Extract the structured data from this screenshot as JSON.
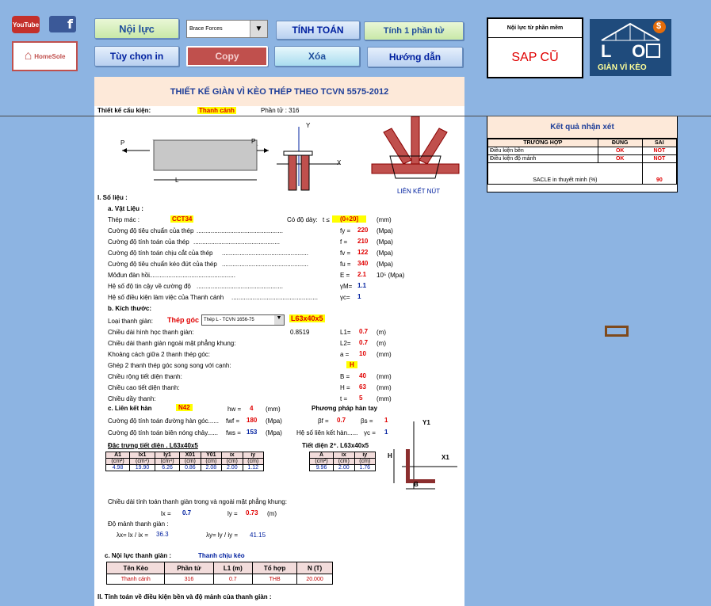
{
  "toolbar": {
    "noi_luc": "Nội lực",
    "brace_select": "Brace Forces",
    "tinh_toan": "TÍNH TOÁN",
    "tinh_1": "Tính 1 phần tử",
    "tuy_chon": "Tùy chọn in",
    "copy": "Copy",
    "xoa": "Xóa",
    "huong_dan": "Hướng dẫn",
    "youtube": "YouTube",
    "facebook": "f",
    "homesole": "HomeSole"
  },
  "software": {
    "title": "Nội lực từ phần mềm",
    "value": "SAP CŨ"
  },
  "logo": {
    "text": "GIÀN VÌ KÈO",
    "letters": "L O",
    "dollar": "$"
  },
  "sheet": {
    "title": "THIẾT KẾ GIÀN VÌ KÈO THÉP THEO TCVN 5575-2012",
    "component_label": "Thiết kế cấu kiện:",
    "component_value": "Thanh cánh",
    "element_label": "Phần tử : 316",
    "diagram": {
      "p_left": "P",
      "p_right": "P",
      "l": "L",
      "y": "Y",
      "x": "X",
      "joint": "LIÊN KẾT NÚT"
    },
    "sec1": "I. Số liệu :",
    "a": "a. Vật Liệu :",
    "thep_mac": "Thép mác :",
    "thep_mac_val": "CCT34",
    "thickness_label": "Có độ dày:",
    "t_label": "t ≤",
    "t_val": "(0÷20]",
    "mm": "(mm)",
    "props": [
      {
        "label": "Cường độ tiêu chuẩn của thép",
        "sym": "fy =",
        "val": "220",
        "unit": "(Mpa)"
      },
      {
        "label": "Cường độ tính toán của thép",
        "sym": "f =",
        "val": "210",
        "unit": "(Mpa)"
      },
      {
        "label": "Cường độ tính toán chịu cắt của thép",
        "sym": "fv =",
        "val": "122",
        "unit": "(Mpa)"
      },
      {
        "label": "Cường độ tiêu chuẩn kéo đứt của thép",
        "sym": "fu =",
        "val": "340",
        "unit": "(Mpa)"
      },
      {
        "label": "Môđun đàn hồi",
        "sym": "E =",
        "val": "2.1",
        "unit": "10⁵ (Mpa)"
      },
      {
        "label": "Hệ số độ tin cậy về cường độ",
        "sym": "γM=",
        "val": "1.1",
        "unit": ""
      },
      {
        "label": "Hệ số điều kiện làm việc của Thanh cánh",
        "sym": "γc=",
        "val": "1",
        "unit": ""
      }
    ],
    "b": "b. Kích thước:",
    "loai": "Loại thanh giàn:",
    "loai_val": "Thép góc",
    "loai_select": "Thép L - TCVN 1656-75",
    "loai_size": "L63x40x5",
    "dims": [
      {
        "label": "Chiều dài hình học thanh giàn:",
        "extra": "0.8519",
        "sym": "L1=",
        "val": "0.7",
        "unit": "(m)"
      },
      {
        "label": "Chiều dài thanh giàn ngoài mặt phẳng khung:",
        "extra": "",
        "sym": "L2=",
        "val": "0.7",
        "unit": "(m)"
      },
      {
        "label": "Khoảng cách giữa 2 thanh thép góc:",
        "extra": "",
        "sym": "a =",
        "val": "10",
        "unit": "(mm)"
      },
      {
        "label": "Ghép 2 thanh thép góc song song với cạnh:",
        "extra": "",
        "sym": "",
        "val": "H",
        "unit": ""
      },
      {
        "label": "Chiều rộng tiết diện thanh:",
        "extra": "",
        "sym": "B =",
        "val": "40",
        "unit": "(mm)"
      },
      {
        "label": "Chiều cao tiết diện thanh:",
        "extra": "",
        "sym": "H =",
        "val": "63",
        "unit": "(mm)"
      },
      {
        "label": "Chiều dầy thanh:",
        "extra": "",
        "sym": "t =",
        "val": "5",
        "unit": "(mm)"
      }
    ],
    "c": "c. Liên kết hàn",
    "c_val": "N42",
    "hw_sym": "hw =",
    "hw_val": "4",
    "hw_unit": "(mm)",
    "method": "Phương pháp hàn tay",
    "weld1": "Cường độ tính toán đường hàn góc......",
    "fwf": "fwf =",
    "fwf_val": "180",
    "mpa": "(Mpa)",
    "bf": "βf =",
    "bf_val": "0.7",
    "bs": "βs =",
    "bs_val": "1",
    "weld2": "Cường độ tính toán biên nóng chảy......",
    "fws": "fws =",
    "fws_val": "153",
    "ylk": "Hệ số liên kết hàn......",
    "yc": "γc =",
    "yc_val": "1",
    "char1": "Đặc trưng tiết diện . L63x40x5",
    "char2": "Tiết diện 2⁺. L63x40x5",
    "t1_head": [
      "A1",
      "Ix1",
      "Iy1",
      "X01",
      "Y01",
      "ix",
      "iy"
    ],
    "t1_unit": [
      "(cm²)",
      "(cm⁴)",
      "(cm⁴)",
      "(cm)",
      "(cm)",
      "(cm)",
      "(cm)"
    ],
    "t1_vals": [
      "4.98",
      "19.90",
      "6.26",
      "0.86",
      "2.08",
      "2.00",
      "1.12"
    ],
    "t2_head": [
      "A",
      "ix",
      "iy"
    ],
    "t2_unit": [
      "(cm²)",
      "(cm)",
      "(cm)"
    ],
    "t2_vals": [
      "9.96",
      "2.00",
      "1.76"
    ],
    "sec_labels": {
      "y1": "Y1",
      "x1": "X1",
      "h": "H",
      "b": "B"
    },
    "len_calc": "Chiều dài tính toán thanh giàn trong và ngoài mặt phẳng khung:",
    "lx": "lx =",
    "lx_val": "0.7",
    "ly": "ly =",
    "ly_val": "0.73",
    "m": "(m)",
    "slender": "Độ mảnh thanh giàn :",
    "lamx": "λx= lx / ix =",
    "lamx_val": "36.3",
    "lamy": "λy= ly / iy =",
    "lamy_val": "41.15",
    "c2": "c. Nội lực thanh giàn :",
    "c2_val": "Thanh chịu kéo",
    "force_head": [
      "Tên Kèo",
      "Phần tử",
      "L1 (m)",
      "Tổ hợp",
      "N (T)"
    ],
    "force_row": [
      "Thanh cánh",
      "316",
      "0.7",
      "THB",
      "20.000"
    ],
    "sec2": "II. Tính toán về điều kiện bền và độ mảnh của thanh giàn :"
  },
  "result": {
    "title": "Kết quả nhận xét",
    "cols": [
      "TRƯỜNG HỢP",
      "ĐÚNG",
      "SAI"
    ],
    "rows": [
      {
        "case": "Điều kiện bền",
        "ok": "OK",
        "not": "NOT"
      },
      {
        "case": "Điều kiện độ mảnh",
        "ok": "OK",
        "not": "NOT"
      }
    ],
    "sacle_label": "SACLE in thuyết minh (%)",
    "sacle_val": "90"
  },
  "colors": {
    "background": "#8db4e2",
    "header": "#fde9d9",
    "accent_red": "#e00000",
    "value_blue": "#00209f",
    "highlight": "#ffff00"
  }
}
